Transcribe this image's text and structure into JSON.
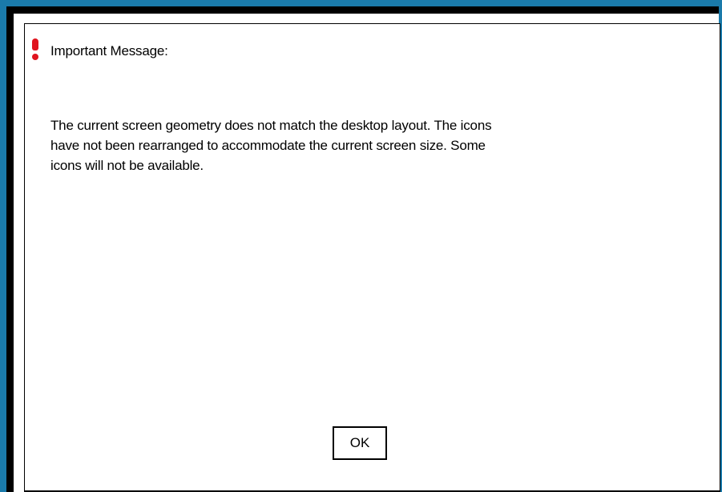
{
  "dialog": {
    "icon": "exclamation-icon",
    "title": "Important Message:",
    "message_lines": [
      "The current screen geometry does not match the desktop layout. The icons",
      "have not been rearranged to accommodate the current screen size.  Some",
      "icons will not be available."
    ],
    "ok_label": "OK"
  },
  "colors": {
    "desktop_border": "#1a7aaa",
    "frame": "#000000",
    "dialog_background": "#ffffff",
    "icon": "#e0141e"
  }
}
